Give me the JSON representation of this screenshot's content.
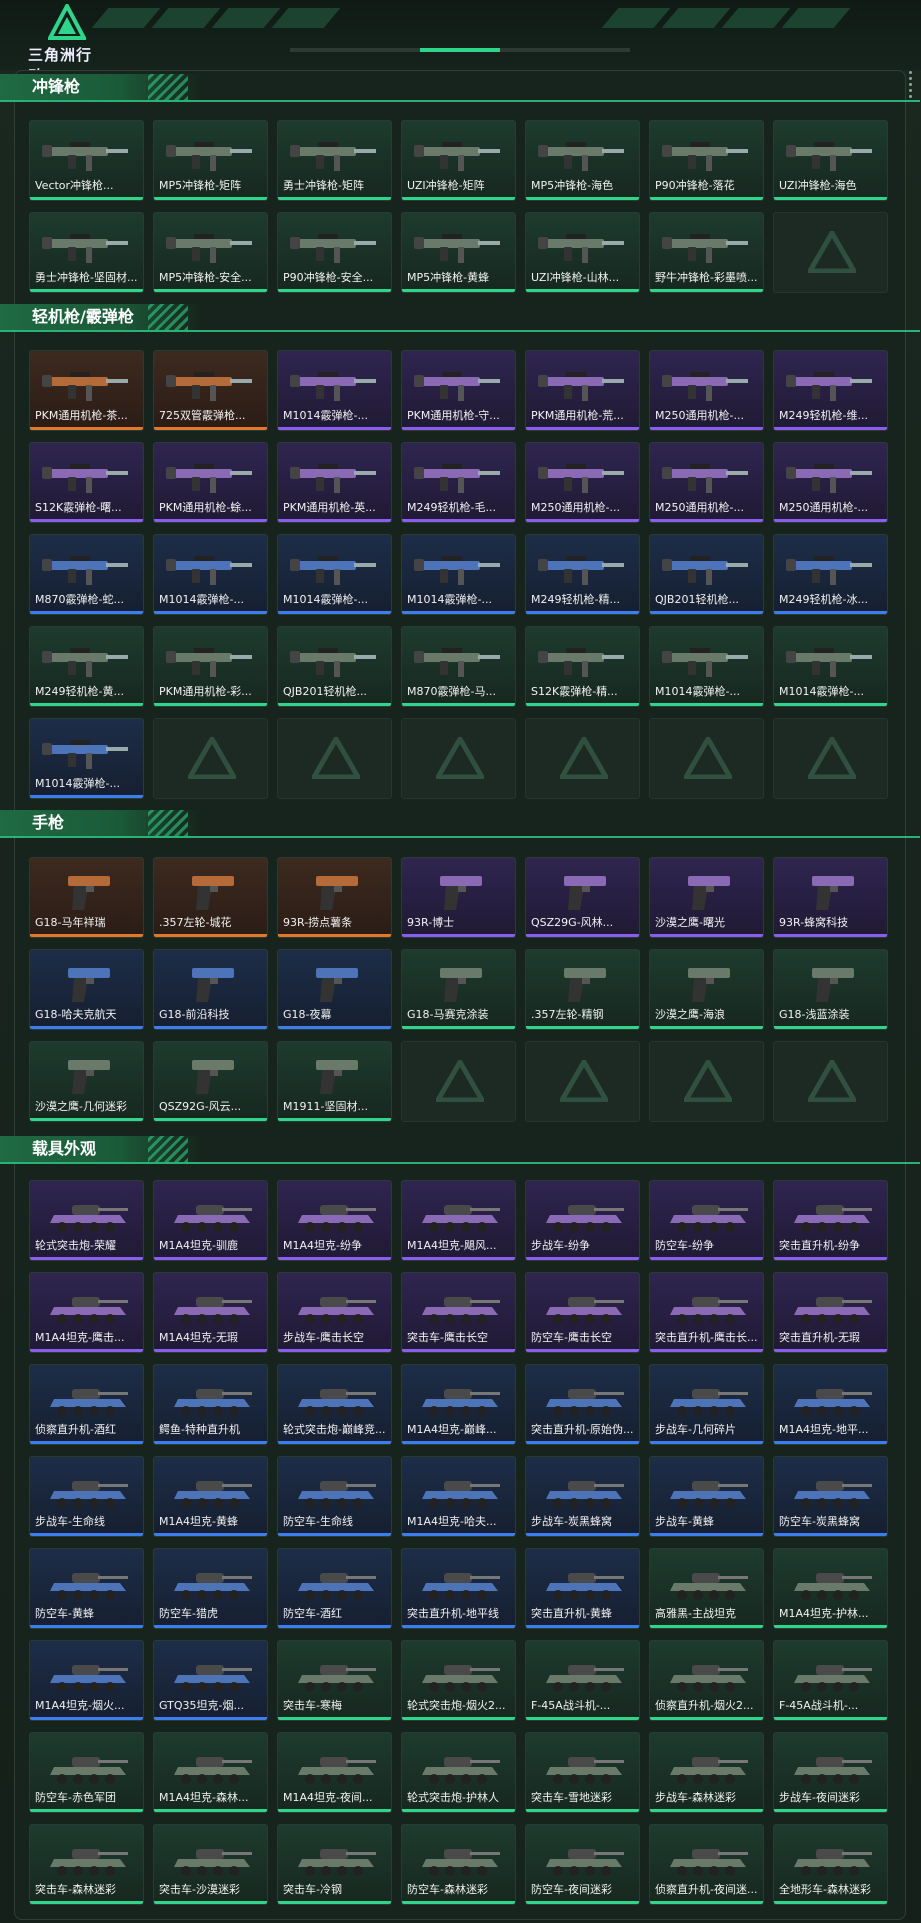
{
  "header": {
    "logo_text": "三角洲行动"
  },
  "sections": [
    {
      "title": "冲锋枪",
      "kind": "gun",
      "items": [
        {
          "name": "Vector冲锋枪...",
          "rarity": "green"
        },
        {
          "name": "MP5冲锋枪-矩阵",
          "rarity": "green"
        },
        {
          "name": "勇士冲锋枪-矩阵",
          "rarity": "green"
        },
        {
          "name": "UZI冲锋枪-矩阵",
          "rarity": "green"
        },
        {
          "name": "MP5冲锋枪-海色",
          "rarity": "green"
        },
        {
          "name": "P90冲锋枪-落花",
          "rarity": "green"
        },
        {
          "name": "UZI冲锋枪-海色",
          "rarity": "green"
        },
        {
          "name": "勇士冲锋枪-坚固材...",
          "rarity": "green"
        },
        {
          "name": "MP5冲锋枪-安全...",
          "rarity": "green"
        },
        {
          "name": "P90冲锋枪-安全...",
          "rarity": "green"
        },
        {
          "name": "MP5冲锋枪-黄蜂",
          "rarity": "green"
        },
        {
          "name": "UZI冲锋枪-山林...",
          "rarity": "green"
        },
        {
          "name": "野牛冲锋枪-彩墨喷...",
          "rarity": "green"
        },
        {
          "name": "",
          "rarity": "empty"
        }
      ]
    },
    {
      "title": "轻机枪/霰弹枪",
      "kind": "gun",
      "items": [
        {
          "name": "PKM通用机枪-茶...",
          "rarity": "orange"
        },
        {
          "name": "725双管霰弹枪...",
          "rarity": "orange"
        },
        {
          "name": "M1014霰弹枪-...",
          "rarity": "purple"
        },
        {
          "name": "PKM通用机枪-守...",
          "rarity": "purple"
        },
        {
          "name": "PKM通用机枪-荒...",
          "rarity": "purple"
        },
        {
          "name": "M250通用机枪-...",
          "rarity": "purple"
        },
        {
          "name": "M249轻机枪-维...",
          "rarity": "purple"
        },
        {
          "name": "S12K霰弹枪-曙...",
          "rarity": "purple"
        },
        {
          "name": "PKM通用机枪-蜍...",
          "rarity": "purple"
        },
        {
          "name": "PKM通用机枪-英...",
          "rarity": "purple"
        },
        {
          "name": "M249轻机枪-毛...",
          "rarity": "purple"
        },
        {
          "name": "M250通用机枪-...",
          "rarity": "purple"
        },
        {
          "name": "M250通用机枪-...",
          "rarity": "purple"
        },
        {
          "name": "M250通用机枪-...",
          "rarity": "purple"
        },
        {
          "name": "M870霰弹枪-蛇...",
          "rarity": "blue"
        },
        {
          "name": "M1014霰弹枪-...",
          "rarity": "blue"
        },
        {
          "name": "M1014霰弹枪-...",
          "rarity": "blue"
        },
        {
          "name": "M1014霰弹枪-...",
          "rarity": "blue"
        },
        {
          "name": "M249轻机枪-精...",
          "rarity": "blue"
        },
        {
          "name": "QJB201轻机枪...",
          "rarity": "blue"
        },
        {
          "name": "M249轻机枪-冰...",
          "rarity": "blue"
        },
        {
          "name": "M249轻机枪-黄...",
          "rarity": "green"
        },
        {
          "name": "PKM通用机枪-彩...",
          "rarity": "green"
        },
        {
          "name": "QJB201轻机枪...",
          "rarity": "green"
        },
        {
          "name": "M870霰弹枪-马...",
          "rarity": "green"
        },
        {
          "name": "S12K霰弹枪-精...",
          "rarity": "green"
        },
        {
          "name": "M1014霰弹枪-...",
          "rarity": "green"
        },
        {
          "name": "M1014霰弹枪-...",
          "rarity": "green"
        },
        {
          "name": "M1014霰弹枪-...",
          "rarity": "blue"
        },
        {
          "name": "",
          "rarity": "empty"
        },
        {
          "name": "",
          "rarity": "empty"
        },
        {
          "name": "",
          "rarity": "empty"
        },
        {
          "name": "",
          "rarity": "empty"
        },
        {
          "name": "",
          "rarity": "empty"
        },
        {
          "name": "",
          "rarity": "empty"
        }
      ]
    },
    {
      "title": "手枪",
      "kind": "pistol",
      "items": [
        {
          "name": "G18-马年祥瑞",
          "rarity": "orange"
        },
        {
          "name": ".357左轮-城花",
          "rarity": "orange"
        },
        {
          "name": "93R-捞点薯条",
          "rarity": "orange"
        },
        {
          "name": "93R-博士",
          "rarity": "purple"
        },
        {
          "name": "QSZ29G-风林...",
          "rarity": "purple"
        },
        {
          "name": "沙漠之鹰-曙光",
          "rarity": "purple"
        },
        {
          "name": "93R-蜂窝科技",
          "rarity": "purple"
        },
        {
          "name": "G18-哈夫克航天",
          "rarity": "blue"
        },
        {
          "name": "G18-前沿科技",
          "rarity": "blue"
        },
        {
          "name": "G18-夜幕",
          "rarity": "blue"
        },
        {
          "name": "G18-马赛克涂装",
          "rarity": "green"
        },
        {
          "name": ".357左轮-精钢",
          "rarity": "green"
        },
        {
          "name": "沙漠之鹰-海浪",
          "rarity": "green"
        },
        {
          "name": "G18-浅蓝涂装",
          "rarity": "green"
        },
        {
          "name": "沙漠之鹰-几何迷彩",
          "rarity": "green"
        },
        {
          "name": "QSZ92G-风云...",
          "rarity": "green"
        },
        {
          "name": "M1911-坚固材...",
          "rarity": "green"
        },
        {
          "name": "",
          "rarity": "empty"
        },
        {
          "name": "",
          "rarity": "empty"
        },
        {
          "name": "",
          "rarity": "empty"
        },
        {
          "name": "",
          "rarity": "empty"
        }
      ]
    },
    {
      "title": "载具外观",
      "kind": "vehicle",
      "items": [
        {
          "name": "轮式突击炮-荣耀",
          "rarity": "purple"
        },
        {
          "name": "M1A4坦克-驯鹿",
          "rarity": "purple"
        },
        {
          "name": "M1A4坦克-纷争",
          "rarity": "purple"
        },
        {
          "name": "M1A4坦克-飓风...",
          "rarity": "purple"
        },
        {
          "name": "步战车-纷争",
          "rarity": "purple"
        },
        {
          "name": "防空车-纷争",
          "rarity": "purple"
        },
        {
          "name": "突击直升机-纷争",
          "rarity": "purple"
        },
        {
          "name": "M1A4坦克-鹰击...",
          "rarity": "purple"
        },
        {
          "name": "M1A4坦克-无瑕",
          "rarity": "purple"
        },
        {
          "name": "步战车-鹰击长空",
          "rarity": "purple"
        },
        {
          "name": "突击车-鹰击长空",
          "rarity": "purple"
        },
        {
          "name": "防空车-鹰击长空",
          "rarity": "purple"
        },
        {
          "name": "突击直升机-鹰击长...",
          "rarity": "purple"
        },
        {
          "name": "突击直升机-无瑕",
          "rarity": "purple"
        },
        {
          "name": "侦察直升机-酒红",
          "rarity": "blue"
        },
        {
          "name": "鳄鱼-特种直升机",
          "rarity": "blue"
        },
        {
          "name": "轮式突击炮-巅峰竞...",
          "rarity": "blue"
        },
        {
          "name": "M1A4坦克-巅峰...",
          "rarity": "blue"
        },
        {
          "name": "突击直升机-原始伪...",
          "rarity": "blue"
        },
        {
          "name": "步战车-几何碎片",
          "rarity": "blue"
        },
        {
          "name": "M1A4坦克-地平...",
          "rarity": "blue"
        },
        {
          "name": "步战车-生命线",
          "rarity": "blue"
        },
        {
          "name": "M1A4坦克-黄蜂",
          "rarity": "blue"
        },
        {
          "name": "防空车-生命线",
          "rarity": "blue"
        },
        {
          "name": "M1A4坦克-哈夫...",
          "rarity": "blue"
        },
        {
          "name": "步战车-炭黑蜂窝",
          "rarity": "blue"
        },
        {
          "name": "步战车-黄蜂",
          "rarity": "blue"
        },
        {
          "name": "防空车-炭黑蜂窝",
          "rarity": "blue"
        },
        {
          "name": "防空车-黄蜂",
          "rarity": "blue"
        },
        {
          "name": "防空车-猎虎",
          "rarity": "blue"
        },
        {
          "name": "防空车-酒红",
          "rarity": "blue"
        },
        {
          "name": "突击直升机-地平线",
          "rarity": "blue"
        },
        {
          "name": "突击直升机-黄蜂",
          "rarity": "blue"
        },
        {
          "name": "高雅黑-主战坦克",
          "rarity": "green"
        },
        {
          "name": "M1A4坦克-护林...",
          "rarity": "green"
        },
        {
          "name": "M1A4坦克-烟火...",
          "rarity": "blue"
        },
        {
          "name": "GTQ35坦克-烟...",
          "rarity": "blue"
        },
        {
          "name": "突击车-寒梅",
          "rarity": "green"
        },
        {
          "name": "轮式突击炮-烟火2...",
          "rarity": "green"
        },
        {
          "name": "F-45A战斗机-...",
          "rarity": "green"
        },
        {
          "name": "侦察直升机-烟火2...",
          "rarity": "green"
        },
        {
          "name": "F-45A战斗机-...",
          "rarity": "green"
        },
        {
          "name": "防空车-赤色军团",
          "rarity": "green"
        },
        {
          "name": "M1A4坦克-森林...",
          "rarity": "green"
        },
        {
          "name": "M1A4坦克-夜间...",
          "rarity": "green"
        },
        {
          "name": "轮式突击炮-护林人",
          "rarity": "green"
        },
        {
          "name": "突击车-雪地迷彩",
          "rarity": "green"
        },
        {
          "name": "步战车-森林迷彩",
          "rarity": "green"
        },
        {
          "name": "步战车-夜间迷彩",
          "rarity": "green"
        },
        {
          "name": "突击车-森林迷彩",
          "rarity": "green"
        },
        {
          "name": "突击车-沙漠迷彩",
          "rarity": "green"
        },
        {
          "name": "突击车-冷钢",
          "rarity": "green"
        },
        {
          "name": "防空车-森林迷彩",
          "rarity": "green"
        },
        {
          "name": "防空车-夜间迷彩",
          "rarity": "green"
        },
        {
          "name": "侦察直升机-夜间迷...",
          "rarity": "green"
        },
        {
          "name": "全地形车-森林迷彩",
          "rarity": "green"
        }
      ]
    }
  ],
  "colors": {
    "accent": "#2fd58b",
    "green": "#2fd58b",
    "blue": "#3c7df0",
    "purple": "#8a5df0",
    "orange": "#e07a2a"
  }
}
